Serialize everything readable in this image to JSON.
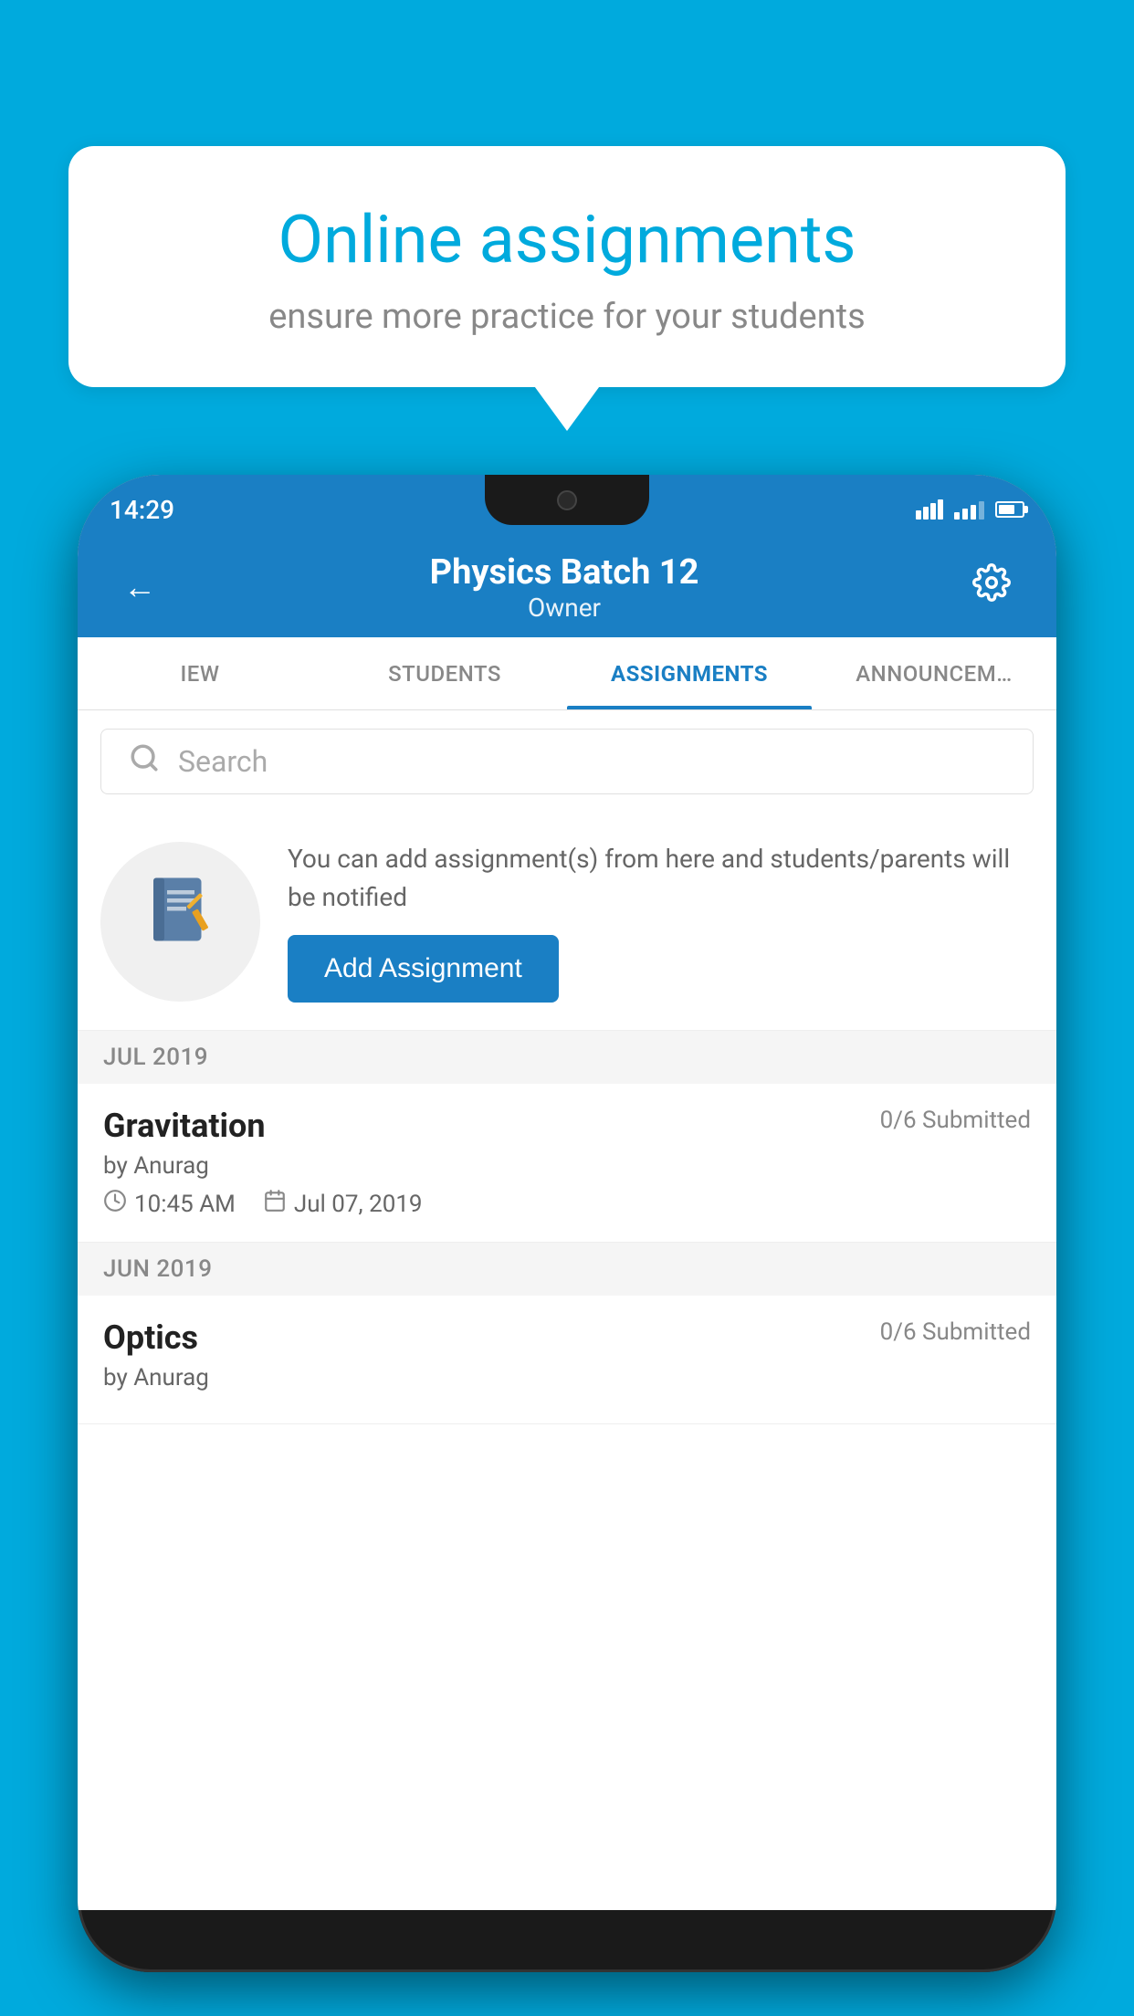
{
  "background_color": "#00AADD",
  "speech_bubble": {
    "title": "Online assignments",
    "subtitle": "ensure more practice for your students"
  },
  "status_bar": {
    "time": "14:29"
  },
  "header": {
    "title": "Physics Batch 12",
    "subtitle": "Owner"
  },
  "tabs": [
    {
      "label": "IEW",
      "active": false
    },
    {
      "label": "STUDENTS",
      "active": false
    },
    {
      "label": "ASSIGNMENTS",
      "active": true
    },
    {
      "label": "ANNOUNCEM…",
      "active": false
    }
  ],
  "search": {
    "placeholder": "Search"
  },
  "promo": {
    "description": "You can add assignment(s) from here and students/parents will be notified",
    "button_label": "Add Assignment"
  },
  "sections": [
    {
      "header": "JUL 2019",
      "assignments": [
        {
          "title": "Gravitation",
          "submitted": "0/6 Submitted",
          "author": "by Anurag",
          "time": "10:45 AM",
          "date": "Jul 07, 2019"
        }
      ]
    },
    {
      "header": "JUN 2019",
      "assignments": [
        {
          "title": "Optics",
          "submitted": "0/6 Submitted",
          "author": "by Anurag",
          "time": "",
          "date": ""
        }
      ]
    }
  ]
}
